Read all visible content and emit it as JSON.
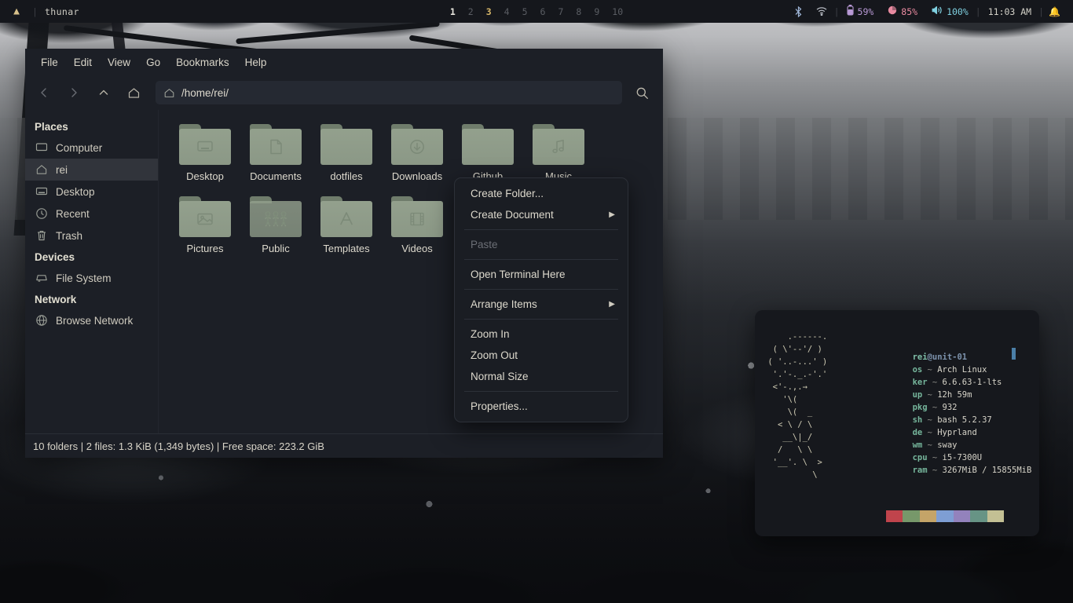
{
  "topbar": {
    "logo_icon": "arch-logo-icon",
    "app_title": "thunar",
    "separator": "|",
    "workspaces": [
      {
        "label": "1",
        "state": "bright"
      },
      {
        "label": "2",
        "state": "idle"
      },
      {
        "label": "3",
        "state": "active"
      },
      {
        "label": "4",
        "state": "idle"
      },
      {
        "label": "5",
        "state": "idle"
      },
      {
        "label": "6",
        "state": "idle"
      },
      {
        "label": "7",
        "state": "idle"
      },
      {
        "label": "8",
        "state": "idle"
      },
      {
        "label": "9",
        "state": "idle"
      },
      {
        "label": "10",
        "state": "idle"
      }
    ],
    "bluetooth_icon": "bluetooth-icon",
    "wifi_icon": "wifi-icon",
    "battery_icon": "battery-icon",
    "battery_label": "59%",
    "memory_icon": "memory-icon",
    "memory_label": "85%",
    "volume_icon": "volume-icon",
    "volume_label": "100%",
    "clock": "11:03 AM",
    "bell_icon": "bell-icon",
    "colors": {
      "background": "#15171c",
      "active_workspace": "#d8b86a",
      "volume": "#7fd0e0",
      "memory": "#e88aa0",
      "battery": "#b99ad6"
    }
  },
  "thunar": {
    "menubar": [
      "File",
      "Edit",
      "View",
      "Go",
      "Bookmarks",
      "Help"
    ],
    "toolbar": {
      "back_icon": "chevron-left-icon",
      "forward_icon": "chevron-right-icon",
      "up_icon": "chevron-up-icon",
      "home_icon": "home-icon",
      "path_icon": "home-small-icon",
      "path_value": "/home/rei/",
      "search_icon": "search-icon"
    },
    "sidebar": {
      "sections": [
        {
          "title": "Places",
          "items": [
            {
              "label": "Computer",
              "icon": "computer-icon",
              "selected": false
            },
            {
              "label": "rei",
              "icon": "home-icon",
              "selected": true
            },
            {
              "label": "Desktop",
              "icon": "desktop-icon",
              "selected": false
            },
            {
              "label": "Recent",
              "icon": "clock-icon",
              "selected": false
            },
            {
              "label": "Trash",
              "icon": "trash-icon",
              "selected": false
            }
          ]
        },
        {
          "title": "Devices",
          "items": [
            {
              "label": "File System",
              "icon": "drive-icon",
              "selected": false
            }
          ]
        },
        {
          "title": "Network",
          "items": [
            {
              "label": "Browse Network",
              "icon": "globe-icon",
              "selected": false
            }
          ]
        }
      ]
    },
    "files": [
      {
        "name": "Desktop",
        "icon": "folder-desktop-icon"
      },
      {
        "name": "Documents",
        "icon": "folder-documents-icon"
      },
      {
        "name": "dotfiles",
        "icon": "folder-plain-icon"
      },
      {
        "name": "Downloads",
        "icon": "folder-downloads-icon"
      },
      {
        "name": "Github",
        "icon": "folder-plain-icon"
      },
      {
        "name": "Music",
        "icon": "folder-music-icon"
      },
      {
        "name": "Pictures",
        "icon": "folder-pictures-icon"
      },
      {
        "name": "Public",
        "icon": "folder-public-icon"
      },
      {
        "name": "Templates",
        "icon": "folder-templates-icon"
      },
      {
        "name": "Videos",
        "icon": "folder-videos-icon"
      }
    ],
    "statusbar": "10 folders  |  2 files: 1.3 KiB (1,349 bytes)  |  Free space: 223.2 GiB",
    "colors": {
      "window_background": "#1c1f26",
      "selection": "#31343b",
      "folder": "#93a08d",
      "text": "#ddd9cd"
    }
  },
  "context_menu": {
    "items": [
      {
        "label": "Create Folder...",
        "submenu": false,
        "disabled": false,
        "sep_after": false
      },
      {
        "label": "Create Document",
        "submenu": true,
        "disabled": false,
        "sep_after": true
      },
      {
        "label": "Paste",
        "submenu": false,
        "disabled": true,
        "sep_after": true
      },
      {
        "label": "Open Terminal Here",
        "submenu": false,
        "disabled": false,
        "sep_after": true
      },
      {
        "label": "Arrange Items",
        "submenu": true,
        "disabled": false,
        "sep_after": true
      },
      {
        "label": "Zoom In",
        "submenu": false,
        "disabled": false,
        "sep_after": false
      },
      {
        "label": "Zoom Out",
        "submenu": false,
        "disabled": false,
        "sep_after": false
      },
      {
        "label": "Normal Size",
        "submenu": false,
        "disabled": false,
        "sep_after": true
      },
      {
        "label": "Properties...",
        "submenu": false,
        "disabled": false,
        "sep_after": false
      }
    ],
    "submenu_arrow": "▶"
  },
  "terminal": {
    "ascii_art": "     .------.\n  ( \\'--'/ )\n ( '..-...' )\n  '.'-._.-'.'\n  <'-.,.→\n    '\\(\n     \\(  _\n   < \\ / \\\n    __\\|_/\n   /   \\ \\\n  '__'. \\  >\n          \\",
    "user": "rei",
    "host": "@unit-01",
    "entries": [
      {
        "key": "os",
        "sep": " ~ ",
        "value": "Arch Linux"
      },
      {
        "key": "ker",
        "sep": " ~ ",
        "value": "6.6.63-1-lts"
      },
      {
        "key": "up",
        "sep": " ~ ",
        "value": "12h 59m"
      },
      {
        "key": "pkg",
        "sep": " ~ ",
        "value": "932"
      },
      {
        "key": "sh",
        "sep": " ~ ",
        "value": "bash 5.2.37"
      },
      {
        "key": "de",
        "sep": " ~ ",
        "value": "Hyprland"
      },
      {
        "key": "wm",
        "sep": " ~ ",
        "value": "sway"
      },
      {
        "key": "cpu",
        "sep": " ~ ",
        "value": "i5-7300U"
      },
      {
        "key": "ram",
        "sep": " ~ ",
        "value": "3267MiB / 15855MiB"
      }
    ],
    "palette": [
      "#c0444c",
      "#77986a",
      "#c4a468",
      "#7e9ed4",
      "#9382bc",
      "#679485",
      "#c3c094"
    ],
    "colors": {
      "background": "#16181d",
      "key": "#76b69c",
      "value": "#d7d4c9",
      "cursor": "#4b7fa8"
    }
  }
}
